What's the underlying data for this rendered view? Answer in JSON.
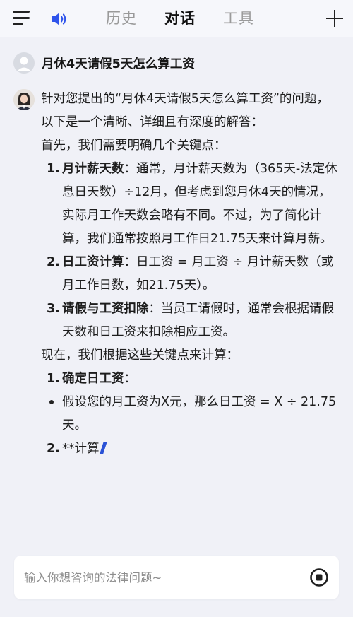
{
  "header": {
    "tabs": [
      {
        "label": "历史",
        "active": false
      },
      {
        "label": "对话",
        "active": true
      },
      {
        "label": "工具",
        "active": false
      }
    ],
    "icons": {
      "menu": "menu-icon",
      "speaker": "speaker-icon",
      "new_chat": "plus-icon"
    },
    "accent_color": "#2f54eb"
  },
  "user": {
    "question": "月休4天请假5天怎么算工资"
  },
  "answer": {
    "intro": "针对您提出的“月休4天请假5天怎么算工资”的问题，以下是一个清晰、详细且有深度的解答：",
    "section1_title": "首先，我们需要明确几个关键点：",
    "points": [
      {
        "num": "1.",
        "term": "月计薪天数",
        "text": "：通常，月计薪天数为（365天-法定休息日天数）÷12月，但考虑到您月休4天的情况，实际月工作天数会略有不同。不过，为了简化计算，我们通常按照月工作日21.75天来计算月薪。"
      },
      {
        "num": "2.",
        "term": "日工资计算",
        "text": "：日工资 = 月工资 ÷ 月计薪天数（或月工作日数，如21.75天）。"
      },
      {
        "num": "3.",
        "term": "请假与工资扣除",
        "text": "：当员工请假时，通常会根据请假天数和日工资来扣除相应工资。"
      }
    ],
    "section2_title": "现在，我们根据这些关键点来计算：",
    "steps": [
      {
        "num": "1.",
        "term": "确定日工资",
        "text": "：",
        "bullet": "假设您的月工资为X元，那么日工资 = X ÷ 21.75天。"
      },
      {
        "num": "2.",
        "text": "**计算"
      }
    ]
  },
  "input": {
    "placeholder": "输入你想咨询的法律问题~",
    "value": ""
  }
}
